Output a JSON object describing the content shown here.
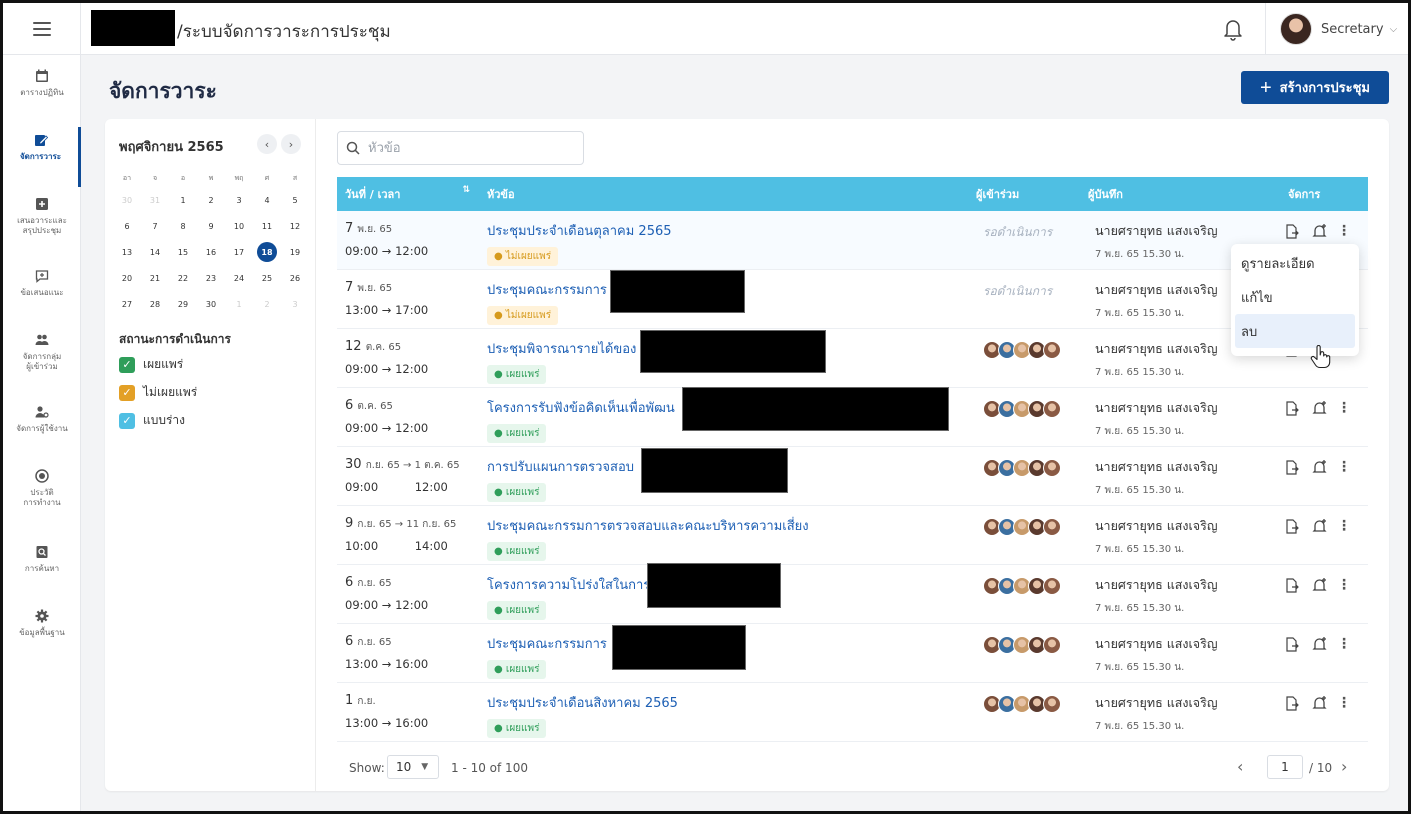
{
  "topbar": {
    "app_title": "/ระบบจัดการวาระการประชุม",
    "user_name": "Secretary"
  },
  "sidebar": {
    "items": [
      {
        "label": "ตารางปฏิทิน",
        "icon": "calendar-icon"
      },
      {
        "label": "จัดการวาระ",
        "icon": "edit-agenda-icon",
        "active": true
      },
      {
        "label": "เสนอวาระและ\nสรุปประชุม",
        "icon": "plus-square-icon"
      },
      {
        "label": "ข้อเสนอแนะ",
        "icon": "feedback-icon"
      },
      {
        "label": "จัดการกลุ่ม\nผู้เข้าร่วม",
        "icon": "group-icon"
      },
      {
        "label": "จัดการผู้ใช้งาน",
        "icon": "user-settings-icon"
      },
      {
        "label": "ประวัติ\nการทำงาน",
        "icon": "history-icon"
      },
      {
        "label": "การค้นหา",
        "icon": "search-doc-icon"
      },
      {
        "label": "ข้อมูลพื้นฐาน",
        "icon": "gear-icon"
      }
    ]
  },
  "page": {
    "title": "จัดการวาระ",
    "create_button": "สร้างการประชุม"
  },
  "calendar": {
    "month": "พฤศจิกายน 2565",
    "weekdays": [
      "อา",
      "จ",
      "อ",
      "พ",
      "พฤ",
      "ศ",
      "ส"
    ],
    "weeks": [
      [
        "30",
        "31",
        "1",
        "2",
        "3",
        "4",
        "5"
      ],
      [
        "6",
        "7",
        "8",
        "9",
        "10",
        "11",
        "12"
      ],
      [
        "13",
        "14",
        "15",
        "16",
        "17",
        "18",
        "19"
      ],
      [
        "20",
        "21",
        "22",
        "23",
        "24",
        "25",
        "26"
      ],
      [
        "27",
        "28",
        "29",
        "30",
        "1",
        "2",
        "3"
      ]
    ],
    "selected_day": "18"
  },
  "status": {
    "title": "สถานะการดำเนินการ",
    "items": [
      {
        "label": "เผยแพร่",
        "color": "#2f9e5a"
      },
      {
        "label": "ไม่เผยแพร่",
        "color": "#e3a026"
      },
      {
        "label": "แบบร่าง",
        "color": "#4fbfe3"
      }
    ]
  },
  "search": {
    "placeholder": "หัวข้อ"
  },
  "table": {
    "headers": {
      "date": "วันที่ / เวลา",
      "topic": "หัวข้อ",
      "attendees": "ผู้เข้าร่วม",
      "recorder": "ผู้บันทึก",
      "manage": "จัดการ"
    },
    "rows": [
      {
        "d_num": "7",
        "d_mon": "พ.ย. 65",
        "time": "09:00 → 12:00",
        "topic": "ประชุมประจำเดือนตุลาคม 2565",
        "status": "ไม่เผยแพร่",
        "status_type": "unpub",
        "attendees": "รอดำเนินการ",
        "recorder": "นายศรายุทธ แสงเจริญ",
        "rec_time": "7 พ.ย. 65 15.30 น."
      },
      {
        "d_num": "7",
        "d_mon": "พ.ย. 65",
        "time": "13:00 → 17:00",
        "topic": "ประชุมคณะกรรมการ",
        "status": "ไม่เผยแพร่",
        "status_type": "unpub",
        "attendees": "รอดำเนินการ",
        "recorder": "นายศรายุทธ แสงเจริญ",
        "rec_time": "7 พ.ย. 65 15.30 น."
      },
      {
        "d_num": "12",
        "d_mon": "ต.ค. 65",
        "time": "09:00 → 12:00",
        "topic": "ประชุมพิจารณารายได้ของ",
        "status": "เผยแพร่",
        "status_type": "pub",
        "attendees": "",
        "recorder": "นายศรายุทธ แสงเจริญ",
        "rec_time": "7 พ.ย. 65 15.30 น."
      },
      {
        "d_num": "6",
        "d_mon": "ต.ค. 65",
        "time": "09:00 → 12:00",
        "topic": "โครงการรับฟังข้อคิดเห็นเพื่อพัฒน",
        "status": "เผยแพร่",
        "status_type": "pub",
        "attendees": "",
        "recorder": "นายศรายุทธ แสงเจริญ",
        "rec_time": "7 พ.ย. 65 15.30 น."
      },
      {
        "d_num": "30",
        "d_mon": "ก.ย. 65 → 1 ต.ค. 65",
        "time": "09:00          12:00",
        "topic": "การปรับแผนการตรวจสอบ",
        "status": "เผยแพร่",
        "status_type": "pub",
        "attendees": "",
        "recorder": "นายศรายุทธ แสงเจริญ",
        "rec_time": "7 พ.ย. 65 15.30 น."
      },
      {
        "d_num": "9",
        "d_mon": "ก.ย. 65 → 11 ก.ย. 65",
        "time": "10:00          14:00",
        "topic": "ประชุมคณะกรรมการตรวจสอบและคณะบริหารความเสี่ยง",
        "status": "เผยแพร่",
        "status_type": "pub",
        "attendees": "",
        "recorder": "นายศรายุทธ แสงเจริญ",
        "rec_time": "7 พ.ย. 65 15.30 น."
      },
      {
        "d_num": "6",
        "d_mon": "ก.ย. 65",
        "time": "09:00 → 12:00",
        "topic": "โครงการความโปร่งใสในการ",
        "status": "เผยแพร่",
        "status_type": "pub",
        "attendees": "",
        "recorder": "นายศรายุทธ แสงเจริญ",
        "rec_time": "7 พ.ย. 65 15.30 น."
      },
      {
        "d_num": "6",
        "d_mon": "ก.ย. 65",
        "time": "13:00 → 16:00",
        "topic": "ประชุมคณะกรรมการ",
        "status": "เผยแพร่",
        "status_type": "pub",
        "attendees": "",
        "recorder": "นายศรายุทธ แสงเจริญ",
        "rec_time": "7 พ.ย. 65 15.30 น."
      },
      {
        "d_num": "1",
        "d_mon": "ก.ย.",
        "time": "13:00 → 16:00",
        "topic": "ประชุมประจำเดือนสิงหาคม 2565",
        "status": "เผยแพร่",
        "status_type": "pub",
        "attendees": "",
        "recorder": "นายศรายุทธ แสงเจริญ",
        "rec_time": "7 พ.ย. 65 15.30 น."
      }
    ]
  },
  "dropdown": {
    "items": [
      "ดูรายละเอียด",
      "แก้ไข",
      "ลบ"
    ],
    "hovered": "ลบ"
  },
  "pagination": {
    "show_label": "Show:",
    "page_size": "10",
    "range": "1 - 10 of 100",
    "current_page": "1",
    "total_pages": "/ 10"
  },
  "colors": {
    "primary": "#0f4c97",
    "table_header": "#4fbfe3",
    "link": "#1d5fb4"
  }
}
